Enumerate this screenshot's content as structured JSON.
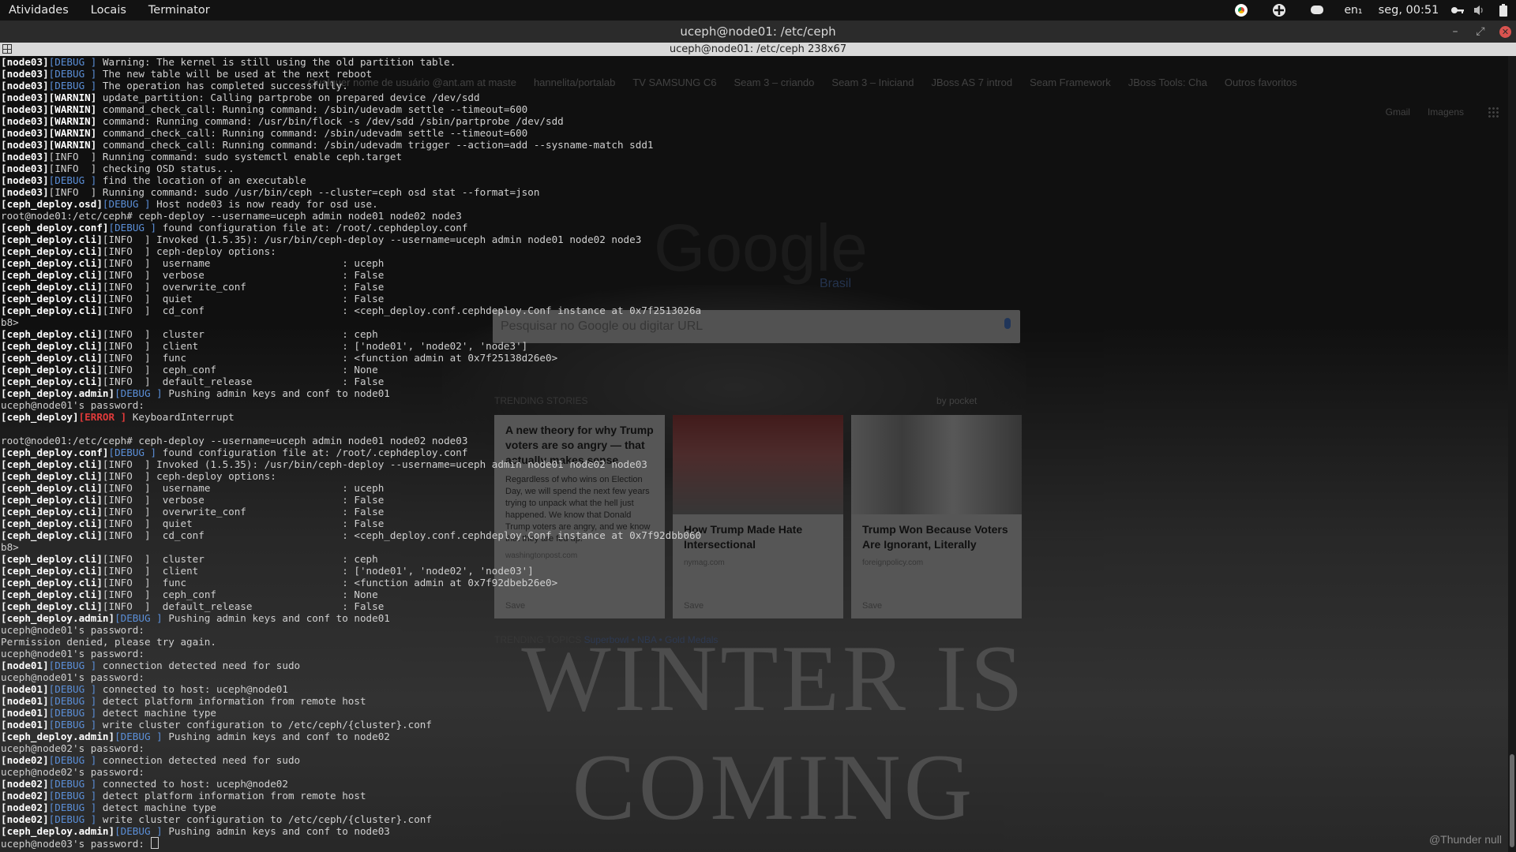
{
  "topbar": {
    "menu": [
      "Atividades",
      "Locais",
      "Terminator"
    ],
    "keyboard": "en₁",
    "clock": "seg, 00:51"
  },
  "window": {
    "title": "uceph@node01: /etc/ceph",
    "terminal_title": "uceph@node01: /etc/ceph 238x67"
  },
  "background": {
    "bookmarks": [
      "hannelita/portalab",
      "TV SAMSUNG C6",
      "Seam 3 – criando",
      "Seam 3 – Iniciand",
      "JBoss AS 7 introd",
      "Seam Framework",
      "JBoss Tools: Cha",
      "Outros favoritos"
    ],
    "bookmark_prefix": "Qualquer nome de usuário @ant.am at maste",
    "gmail": "Gmail",
    "imagens": "Imagens",
    "google": "Google",
    "brasil": "Brasil",
    "search_placeholder": "Pesquisar no Google ou digitar URL",
    "trending": "TRENDING STORIES",
    "by_pocket": "by pocket",
    "cards": [
      {
        "title": "A new theory for why Trump voters are so angry — that actually makes sense",
        "body": "Regardless of who wins on Election Day, we will spend the next few years trying to unpack what the hell just happened. We know that Donald Trump voters are angry, and we know that they are fed up.",
        "source": "washingtonpost.com",
        "save": "Save"
      },
      {
        "title": "How Trump Made Hate Intersectional",
        "body": "",
        "source": "nymag.com",
        "save": "Save"
      },
      {
        "title": "Trump Won Because Voters Are Ignorant, Literally",
        "body": "",
        "source": "foreignpolicy.com",
        "save": "Save"
      }
    ],
    "trending_topics": "TRENDING TOPICS",
    "topic_links": "Superbowl • NBA • Gold Medals",
    "watermark": "WINTER IS COMING",
    "thunder": "@Thunder null"
  },
  "terminal": {
    "lines": [
      [
        [
          "[",
          "w"
        ],
        [
          "node03",
          "w"
        ],
        [
          "]",
          "w"
        ],
        [
          "[DEBUG ]",
          "dbg"
        ],
        [
          " Warning: The kernel is still using the old partition table.",
          ""
        ]
      ],
      [
        [
          "[node03]",
          "w"
        ],
        [
          "[DEBUG ]",
          "dbg"
        ],
        [
          " The new table will be used at the next reboot",
          ""
        ]
      ],
      [
        [
          "[node03]",
          "w"
        ],
        [
          "[DEBUG ]",
          "dbg"
        ],
        [
          " The operation has completed successfully.",
          ""
        ]
      ],
      [
        [
          "[node03]",
          "w"
        ],
        [
          "[WARNIN]",
          "warn"
        ],
        [
          " update_partition: Calling partprobe on prepared device /dev/sdd",
          ""
        ]
      ],
      [
        [
          "[node03]",
          "w"
        ],
        [
          "[WARNIN]",
          "warn"
        ],
        [
          " command_check_call: Running command: /sbin/udevadm settle --timeout=600",
          ""
        ]
      ],
      [
        [
          "[node03]",
          "w"
        ],
        [
          "[WARNIN]",
          "warn"
        ],
        [
          " command: Running command: /usr/bin/flock -s /dev/sdd /sbin/partprobe /dev/sdd",
          ""
        ]
      ],
      [
        [
          "[node03]",
          "w"
        ],
        [
          "[WARNIN]",
          "warn"
        ],
        [
          " command_check_call: Running command: /sbin/udevadm settle --timeout=600",
          ""
        ]
      ],
      [
        [
          "[node03]",
          "w"
        ],
        [
          "[WARNIN]",
          "warn"
        ],
        [
          " command_check_call: Running command: /sbin/udevadm trigger --action=add --sysname-match sdd1",
          ""
        ]
      ],
      [
        [
          "[node03]",
          "w"
        ],
        [
          "[INFO  ]",
          "info"
        ],
        [
          " Running command: sudo systemctl enable ceph.target",
          ""
        ]
      ],
      [
        [
          "[node03]",
          "w"
        ],
        [
          "[INFO  ]",
          "info"
        ],
        [
          " checking OSD status...",
          ""
        ]
      ],
      [
        [
          "[node03]",
          "w"
        ],
        [
          "[DEBUG ]",
          "dbg"
        ],
        [
          " find the location of an executable",
          ""
        ]
      ],
      [
        [
          "[node03]",
          "w"
        ],
        [
          "[INFO  ]",
          "info"
        ],
        [
          " Running command: sudo /usr/bin/ceph --cluster=ceph osd stat --format=json",
          ""
        ]
      ],
      [
        [
          "[ceph_deploy.osd]",
          "w"
        ],
        [
          "[DEBUG ]",
          "dbg"
        ],
        [
          " Host node03 is now ready for osd use.",
          ""
        ]
      ],
      [
        [
          "root@node01:/etc/ceph# ceph-deploy --username=uceph admin node01 node02 node3",
          ""
        ]
      ],
      [
        [
          "[ceph_deploy.conf]",
          "w"
        ],
        [
          "[DEBUG ]",
          "dbg"
        ],
        [
          " found configuration file at: /root/.cephdeploy.conf",
          ""
        ]
      ],
      [
        [
          "[ceph_deploy.cli]",
          "w"
        ],
        [
          "[INFO  ]",
          "info"
        ],
        [
          " Invoked (1.5.35): /usr/bin/ceph-deploy --username=uceph admin node01 node02 node3",
          ""
        ]
      ],
      [
        [
          "[ceph_deploy.cli]",
          "w"
        ],
        [
          "[INFO  ]",
          "info"
        ],
        [
          " ceph-deploy options:",
          ""
        ]
      ],
      [
        [
          "[ceph_deploy.cli]",
          "w"
        ],
        [
          "[INFO  ]",
          "info"
        ],
        [
          "  username                      : uceph",
          ""
        ]
      ],
      [
        [
          "[ceph_deploy.cli]",
          "w"
        ],
        [
          "[INFO  ]",
          "info"
        ],
        [
          "  verbose                       : False",
          ""
        ]
      ],
      [
        [
          "[ceph_deploy.cli]",
          "w"
        ],
        [
          "[INFO  ]",
          "info"
        ],
        [
          "  overwrite_conf                : False",
          ""
        ]
      ],
      [
        [
          "[ceph_deploy.cli]",
          "w"
        ],
        [
          "[INFO  ]",
          "info"
        ],
        [
          "  quiet                         : False",
          ""
        ]
      ],
      [
        [
          "[ceph_deploy.cli]",
          "w"
        ],
        [
          "[INFO  ]",
          "info"
        ],
        [
          "  cd_conf                       : <ceph_deploy.conf.cephdeploy.Conf instance at 0x7f2513026a",
          ""
        ]
      ],
      [
        [
          "b8>",
          ""
        ]
      ],
      [
        [
          "[ceph_deploy.cli]",
          "w"
        ],
        [
          "[INFO  ]",
          "info"
        ],
        [
          "  cluster                       : ceph",
          ""
        ]
      ],
      [
        [
          "[ceph_deploy.cli]",
          "w"
        ],
        [
          "[INFO  ]",
          "info"
        ],
        [
          "  client                        : ['node01', 'node02', 'node3']",
          ""
        ]
      ],
      [
        [
          "[ceph_deploy.cli]",
          "w"
        ],
        [
          "[INFO  ]",
          "info"
        ],
        [
          "  func                          : <function admin at 0x7f25138d26e0>",
          ""
        ]
      ],
      [
        [
          "[ceph_deploy.cli]",
          "w"
        ],
        [
          "[INFO  ]",
          "info"
        ],
        [
          "  ceph_conf                     : None",
          ""
        ]
      ],
      [
        [
          "[ceph_deploy.cli]",
          "w"
        ],
        [
          "[INFO  ]",
          "info"
        ],
        [
          "  default_release               : False",
          ""
        ]
      ],
      [
        [
          "[ceph_deploy.admin]",
          "w"
        ],
        [
          "[DEBUG ]",
          "dbg"
        ],
        [
          " Pushing admin keys and conf to node01",
          ""
        ]
      ],
      [
        [
          "uceph@node01's password:",
          ""
        ]
      ],
      [
        [
          "[ceph_deploy]",
          "w"
        ],
        [
          "[ERROR ]",
          "err"
        ],
        [
          " KeyboardInterrupt",
          ""
        ]
      ],
      [
        [
          "",
          ""
        ]
      ],
      [
        [
          "root@node01:/etc/ceph# ceph-deploy --username=uceph admin node01 node02 node03",
          ""
        ]
      ],
      [
        [
          "[ceph_deploy.conf]",
          "w"
        ],
        [
          "[DEBUG ]",
          "dbg"
        ],
        [
          " found configuration file at: /root/.cephdeploy.conf",
          ""
        ]
      ],
      [
        [
          "[ceph_deploy.cli]",
          "w"
        ],
        [
          "[INFO  ]",
          "info"
        ],
        [
          " Invoked (1.5.35): /usr/bin/ceph-deploy --username=uceph admin node01 node02 node03",
          ""
        ]
      ],
      [
        [
          "[ceph_deploy.cli]",
          "w"
        ],
        [
          "[INFO  ]",
          "info"
        ],
        [
          " ceph-deploy options:",
          ""
        ]
      ],
      [
        [
          "[ceph_deploy.cli]",
          "w"
        ],
        [
          "[INFO  ]",
          "info"
        ],
        [
          "  username                      : uceph",
          ""
        ]
      ],
      [
        [
          "[ceph_deploy.cli]",
          "w"
        ],
        [
          "[INFO  ]",
          "info"
        ],
        [
          "  verbose                       : False",
          ""
        ]
      ],
      [
        [
          "[ceph_deploy.cli]",
          "w"
        ],
        [
          "[INFO  ]",
          "info"
        ],
        [
          "  overwrite_conf                : False",
          ""
        ]
      ],
      [
        [
          "[ceph_deploy.cli]",
          "w"
        ],
        [
          "[INFO  ]",
          "info"
        ],
        [
          "  quiet                         : False",
          ""
        ]
      ],
      [
        [
          "[ceph_deploy.cli]",
          "w"
        ],
        [
          "[INFO  ]",
          "info"
        ],
        [
          "  cd_conf                       : <ceph_deploy.conf.cephdeploy.Conf instance at 0x7f92dbb060",
          ""
        ]
      ],
      [
        [
          "b8>",
          ""
        ]
      ],
      [
        [
          "[ceph_deploy.cli]",
          "w"
        ],
        [
          "[INFO  ]",
          "info"
        ],
        [
          "  cluster                       : ceph",
          ""
        ]
      ],
      [
        [
          "[ceph_deploy.cli]",
          "w"
        ],
        [
          "[INFO  ]",
          "info"
        ],
        [
          "  client                        : ['node01', 'node02', 'node03']",
          ""
        ]
      ],
      [
        [
          "[ceph_deploy.cli]",
          "w"
        ],
        [
          "[INFO  ]",
          "info"
        ],
        [
          "  func                          : <function admin at 0x7f92dbeb26e0>",
          ""
        ]
      ],
      [
        [
          "[ceph_deploy.cli]",
          "w"
        ],
        [
          "[INFO  ]",
          "info"
        ],
        [
          "  ceph_conf                     : None",
          ""
        ]
      ],
      [
        [
          "[ceph_deploy.cli]",
          "w"
        ],
        [
          "[INFO  ]",
          "info"
        ],
        [
          "  default_release               : False",
          ""
        ]
      ],
      [
        [
          "[ceph_deploy.admin]",
          "w"
        ],
        [
          "[DEBUG ]",
          "dbg"
        ],
        [
          " Pushing admin keys and conf to node01",
          ""
        ]
      ],
      [
        [
          "uceph@node01's password:",
          ""
        ]
      ],
      [
        [
          "Permission denied, please try again.",
          ""
        ]
      ],
      [
        [
          "uceph@node01's password:",
          ""
        ]
      ],
      [
        [
          "[node01]",
          "w"
        ],
        [
          "[DEBUG ]",
          "dbg"
        ],
        [
          " connection detected need for sudo",
          ""
        ]
      ],
      [
        [
          "uceph@node01's password:",
          ""
        ]
      ],
      [
        [
          "[node01]",
          "w"
        ],
        [
          "[DEBUG ]",
          "dbg"
        ],
        [
          " connected to host: uceph@node01",
          ""
        ]
      ],
      [
        [
          "[node01]",
          "w"
        ],
        [
          "[DEBUG ]",
          "dbg"
        ],
        [
          " detect platform information from remote host",
          ""
        ]
      ],
      [
        [
          "[node01]",
          "w"
        ],
        [
          "[DEBUG ]",
          "dbg"
        ],
        [
          " detect machine type",
          ""
        ]
      ],
      [
        [
          "[node01]",
          "w"
        ],
        [
          "[DEBUG ]",
          "dbg"
        ],
        [
          " write cluster configuration to /etc/ceph/{cluster}.conf",
          ""
        ]
      ],
      [
        [
          "[ceph_deploy.admin]",
          "w"
        ],
        [
          "[DEBUG ]",
          "dbg"
        ],
        [
          " Pushing admin keys and conf to node02",
          ""
        ]
      ],
      [
        [
          "uceph@node02's password:",
          ""
        ]
      ],
      [
        [
          "[node02]",
          "w"
        ],
        [
          "[DEBUG ]",
          "dbg"
        ],
        [
          " connection detected need for sudo",
          ""
        ]
      ],
      [
        [
          "uceph@node02's password:",
          ""
        ]
      ],
      [
        [
          "[node02]",
          "w"
        ],
        [
          "[DEBUG ]",
          "dbg"
        ],
        [
          " connected to host: uceph@node02",
          ""
        ]
      ],
      [
        [
          "[node02]",
          "w"
        ],
        [
          "[DEBUG ]",
          "dbg"
        ],
        [
          " detect platform information from remote host",
          ""
        ]
      ],
      [
        [
          "[node02]",
          "w"
        ],
        [
          "[DEBUG ]",
          "dbg"
        ],
        [
          " detect machine type",
          ""
        ]
      ],
      [
        [
          "[node02]",
          "w"
        ],
        [
          "[DEBUG ]",
          "dbg"
        ],
        [
          " write cluster configuration to /etc/ceph/{cluster}.conf",
          ""
        ]
      ],
      [
        [
          "[ceph_deploy.admin]",
          "w"
        ],
        [
          "[DEBUG ]",
          "dbg"
        ],
        [
          " Pushing admin keys and conf to node03",
          ""
        ]
      ],
      [
        [
          "uceph@node03's password: ",
          ""
        ]
      ]
    ]
  },
  "colors": {
    "debug": "#5b8fd8",
    "error": "#e03a3a",
    "close": "#d9534f"
  }
}
